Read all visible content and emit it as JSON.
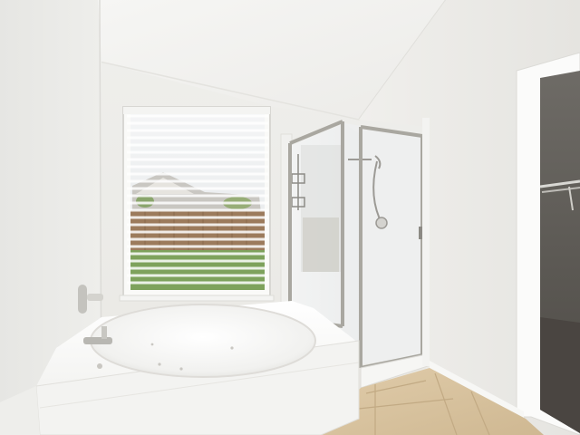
{
  "scene": {
    "subject": "bathroom-interior",
    "elements": [
      "vaulted-ceiling",
      "window-with-blinds",
      "garden-tub",
      "glass-shower",
      "closet-doorway",
      "tile-floor"
    ],
    "colors": {
      "wall": "#ecebe8",
      "ceiling": "#f3f3f1",
      "tub": "#f7f7f5",
      "tile": "#d8c3a0",
      "frame": "#a9a7a0",
      "closet": "#55524d",
      "grass": "#7ea25c",
      "fence": "#9c7b5c"
    }
  }
}
